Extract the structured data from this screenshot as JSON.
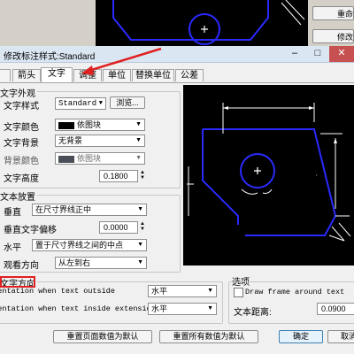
{
  "background": {
    "button_1": "重命",
    "button_2": "修改"
  },
  "dialog": {
    "title": "修改标注样式:Standard",
    "tabs": [
      "箭头",
      "文字",
      "调整",
      "单位",
      "替换单位",
      "公差"
    ],
    "active_tab": "文字",
    "appearance": {
      "group_label": "文字外观",
      "style_label": "文字样式",
      "style_value": "Standard",
      "browse_label": "浏览...",
      "color_label": "文字颜色",
      "color_value": "依图块",
      "bg_label": "文字背景",
      "bg_value": "无背景",
      "bgcolor_label": "背景颜色",
      "bgcolor_value": "依图块",
      "height_label": "文字高度",
      "height_value": "0.1800"
    },
    "placement": {
      "group_label": "文本放置",
      "vertical_label": "垂直",
      "vertical_value": "在尺寸界线正中",
      "offset_label": "垂直文字偏移",
      "offset_value": "0.0000",
      "horizontal_label": "水平",
      "horizontal_value": "置于尺寸界线之间的中点",
      "view_label": "观看方向",
      "view_value": "从左到右"
    },
    "direction": {
      "group_label": "文字方向",
      "outside_label": "Orientation when text outside",
      "outside_value": "水平",
      "inside_label": "Orientation when text inside extension",
      "inside_value": "水平"
    },
    "options": {
      "group_label": "选项",
      "frame_label": "Draw frame around text",
      "frame_checked": false,
      "distance_label": "文本距离:",
      "distance_value": "0.0900"
    },
    "buttons": {
      "reset_page": "重置页面数值为默认",
      "reset_all": "重置所有数值为默认",
      "ok": "确定",
      "cancel": "取消"
    }
  },
  "colors": {
    "highlight": "#e02020",
    "drawing_lines": "#2a2aff",
    "preview_bg": "#000000"
  }
}
